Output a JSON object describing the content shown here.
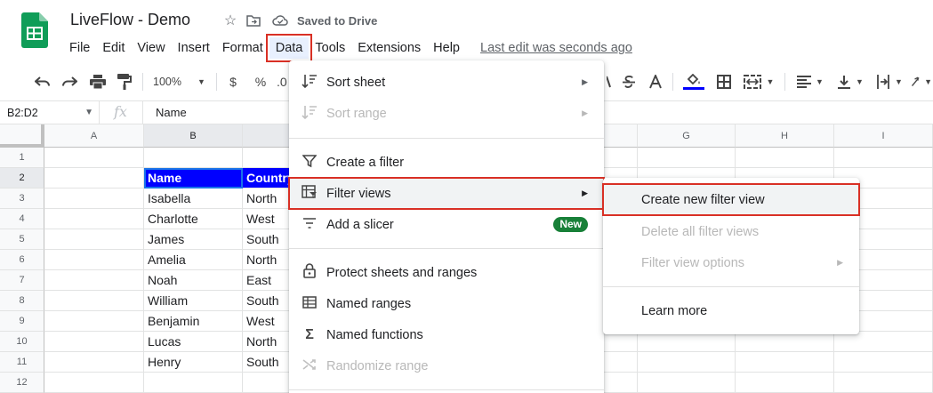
{
  "header": {
    "title": "LiveFlow - Demo",
    "saved_status": "Saved to Drive",
    "last_edit": "Last edit was seconds ago",
    "brand_color": "#0f9d58"
  },
  "menubar": {
    "items": [
      "File",
      "Edit",
      "View",
      "Insert",
      "Format",
      "Data",
      "Tools",
      "Extensions",
      "Help"
    ],
    "active": "Data"
  },
  "toolbar": {
    "zoom": "100%",
    "currency": "$",
    "percent": "%",
    "decimal": ".0"
  },
  "formula_bar": {
    "name_box": "B2:D2",
    "fx": "fx",
    "content": "Name"
  },
  "grid": {
    "columns": [
      "A",
      "B",
      "",
      "",
      "",
      "",
      "G",
      "H",
      "I"
    ],
    "rows": [
      "1",
      "2",
      "3",
      "4",
      "5",
      "6",
      "7",
      "8",
      "9",
      "10",
      "11",
      "12"
    ],
    "header_row": [
      "Name",
      "Country"
    ],
    "data": [
      [
        "Isabella",
        "North"
      ],
      [
        "Charlotte",
        "West"
      ],
      [
        "James",
        "South"
      ],
      [
        "Amelia",
        "North"
      ],
      [
        "Noah",
        "East"
      ],
      [
        "William",
        "South"
      ],
      [
        "Benjamin",
        "West"
      ],
      [
        "Lucas",
        "North"
      ],
      [
        "Henry",
        "South"
      ]
    ]
  },
  "data_menu": {
    "items": [
      {
        "label": "Sort sheet",
        "icon": "sort-icon",
        "glyph": "⇅",
        "submenu": true,
        "disabled": false
      },
      {
        "label": "Sort range",
        "icon": "sort-range-icon",
        "glyph": "⇅",
        "submenu": true,
        "disabled": true
      },
      {
        "label": "Create a filter",
        "icon": "filter-icon",
        "glyph": "⏷",
        "submenu": false,
        "disabled": false
      },
      {
        "label": "Filter views",
        "icon": "filter-views-icon",
        "glyph": "▦",
        "submenu": true,
        "disabled": false
      },
      {
        "label": "Add a slicer",
        "icon": "slicer-icon",
        "glyph": "≡",
        "badge": "New",
        "disabled": false
      },
      {
        "label": "Protect sheets and ranges",
        "icon": "lock-icon",
        "glyph": "🔒︎",
        "disabled": false
      },
      {
        "label": "Named ranges",
        "icon": "named-ranges-icon",
        "glyph": "⊞",
        "disabled": false
      },
      {
        "label": "Named functions",
        "icon": "sigma-icon",
        "glyph": "Σ",
        "disabled": false
      },
      {
        "label": "Randomize range",
        "icon": "shuffle-icon",
        "glyph": "⤨",
        "disabled": true
      }
    ]
  },
  "filter_views_submenu": {
    "items": [
      {
        "label": "Create new filter view",
        "disabled": false
      },
      {
        "label": "Delete all filter views",
        "disabled": true
      },
      {
        "label": "Filter view options",
        "disabled": true,
        "submenu": true
      },
      {
        "label": "Learn more",
        "disabled": false
      }
    ]
  },
  "colors": {
    "highlight_border": "#d93025",
    "selection": "#1a73e8",
    "header_fill": "#0000ff",
    "badge": "#188038"
  }
}
